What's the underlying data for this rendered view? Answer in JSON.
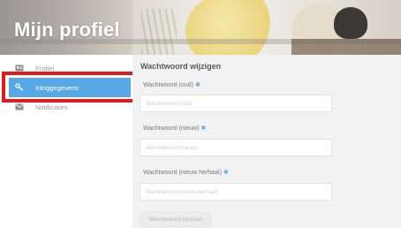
{
  "header": {
    "title": "Mijn profiel"
  },
  "sidebar": {
    "items": [
      {
        "label": "Profiel",
        "icon": "profile-card-icon",
        "active": false
      },
      {
        "label": "Inloggegevens",
        "icon": "key-icon",
        "active": true
      },
      {
        "label": "Notificaties",
        "icon": "envelope-icon",
        "active": false
      }
    ]
  },
  "main": {
    "section_title": "Wachtwoord wijzigen",
    "required_marker": "✱",
    "fields": [
      {
        "label": "Wachtwoord (oud)",
        "placeholder": "Wachtwoord (oud)",
        "value": ""
      },
      {
        "label": "Wachtwoord (nieuw)",
        "placeholder": "Wachtwoord (nieuw)",
        "value": ""
      },
      {
        "label": "Wachtwoord (nieuw herhaal)",
        "placeholder": "Wachtwoord (nieuw herhaal)",
        "value": ""
      }
    ],
    "save_label": "Wachtwoord opslaan"
  },
  "colors": {
    "accent": "#58a8e6",
    "highlight_border": "#e21b1b",
    "content_background": "#f2f2f2"
  }
}
